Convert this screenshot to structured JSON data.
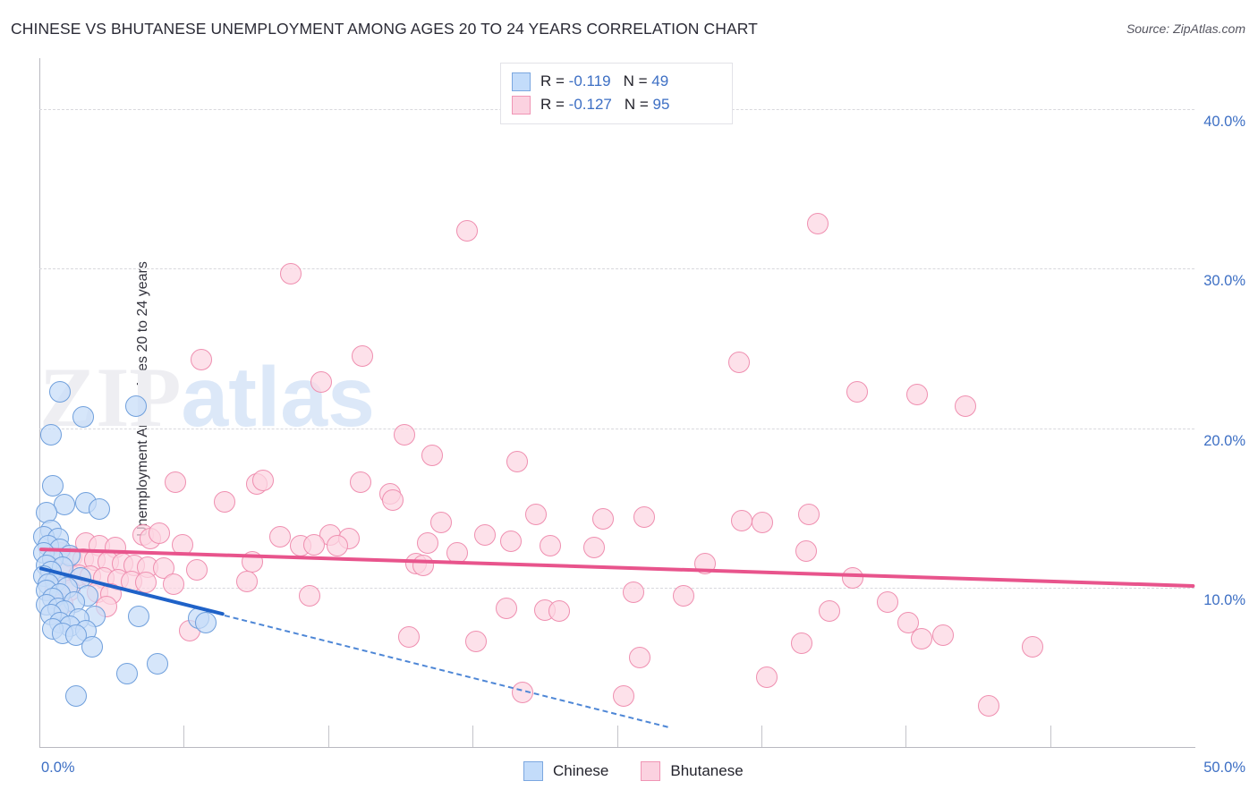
{
  "title": "CHINESE VS BHUTANESE UNEMPLOYMENT AMONG AGES 20 TO 24 YEARS CORRELATION CHART",
  "source": "Source: ZipAtlas.com",
  "watermark": {
    "part1": "ZIP",
    "part2": "atlas"
  },
  "stats": {
    "rows": [
      {
        "series": "Chinese",
        "r_label": "R = ",
        "r_value": "-0.119",
        "n_label": "N = ",
        "n_value": "49",
        "color": "#c3dcfa"
      },
      {
        "series": "Bhutanese",
        "r_label": "R = ",
        "r_value": "-0.127",
        "n_label": "N = ",
        "n_value": "95",
        "color": "#fbd2e0"
      }
    ]
  },
  "legend": {
    "items": [
      {
        "label": "Chinese",
        "color": "#c3dcfa"
      },
      {
        "label": "Bhutanese",
        "color": "#fbd2e0"
      }
    ]
  },
  "chart_data": {
    "type": "scatter",
    "title": "CHINESE VS BHUTANESE UNEMPLOYMENT AMONG AGES 20 TO 24 YEARS CORRELATION CHART",
    "xlabel": "",
    "ylabel": "Unemployment Among Ages 20 to 24 years",
    "xlim": [
      0,
      50
    ],
    "ylim": [
      0,
      43.2
    ],
    "grid": true,
    "x_ticks": [
      0,
      50
    ],
    "x_tick_labels": [
      "0.0%",
      "50.0%"
    ],
    "y_ticks": [
      10,
      20,
      30,
      40
    ],
    "y_tick_labels": [
      "10.0%",
      "20.0%",
      "30.0%",
      "40.0%"
    ],
    "legend_position": "bottom-center",
    "series": [
      {
        "name": "Chinese",
        "color": "#c3dcfa",
        "edge_color": "#6f9fdc",
        "r": -0.119,
        "n": 49,
        "trend": {
          "x0": 0.0,
          "y0": 11.2,
          "x1": 8.0,
          "y1": 8.3,
          "style": "solid"
        },
        "trend_extension": {
          "x0": 8.0,
          "y0": 8.3,
          "x1": 27.2,
          "y1": 1.3,
          "style": "dashed"
        },
        "points": [
          [
            0.9,
            22.3
          ],
          [
            4.2,
            21.4
          ],
          [
            1.9,
            20.7
          ],
          [
            0.5,
            19.6
          ],
          [
            0.6,
            16.4
          ],
          [
            1.1,
            15.2
          ],
          [
            2.0,
            15.3
          ],
          [
            2.6,
            14.9
          ],
          [
            0.3,
            14.7
          ],
          [
            0.5,
            13.6
          ],
          [
            0.2,
            13.2
          ],
          [
            0.8,
            13.1
          ],
          [
            0.4,
            12.6
          ],
          [
            0.9,
            12.4
          ],
          [
            0.2,
            12.2
          ],
          [
            1.3,
            12.0
          ],
          [
            0.6,
            11.8
          ],
          [
            0.3,
            11.4
          ],
          [
            1.0,
            11.3
          ],
          [
            0.5,
            11.0
          ],
          [
            0.2,
            10.7
          ],
          [
            1.8,
            10.6
          ],
          [
            0.7,
            10.4
          ],
          [
            0.4,
            10.2
          ],
          [
            1.2,
            10.0
          ],
          [
            0.3,
            9.8
          ],
          [
            0.9,
            9.6
          ],
          [
            2.1,
            9.5
          ],
          [
            0.6,
            9.3
          ],
          [
            1.5,
            9.1
          ],
          [
            0.3,
            8.9
          ],
          [
            0.8,
            8.7
          ],
          [
            1.1,
            8.5
          ],
          [
            0.5,
            8.3
          ],
          [
            2.4,
            8.2
          ],
          [
            1.7,
            8.0
          ],
          [
            0.9,
            7.8
          ],
          [
            1.3,
            7.6
          ],
          [
            0.6,
            7.4
          ],
          [
            2.0,
            7.3
          ],
          [
            1.0,
            7.1
          ],
          [
            1.6,
            7.0
          ],
          [
            4.3,
            8.2
          ],
          [
            6.9,
            8.1
          ],
          [
            7.2,
            7.8
          ],
          [
            2.3,
            6.3
          ],
          [
            5.1,
            5.2
          ],
          [
            3.8,
            4.6
          ],
          [
            1.6,
            3.2
          ]
        ]
      },
      {
        "name": "Bhutanese",
        "color": "#fbd2e0",
        "edge_color": "#ef8fb0",
        "r": -0.127,
        "n": 95,
        "trend": {
          "x0": 0.0,
          "y0": 12.4,
          "x1": 50.0,
          "y1": 10.1,
          "style": "solid"
        },
        "points": [
          [
            18.5,
            32.4
          ],
          [
            33.7,
            32.8
          ],
          [
            10.9,
            29.7
          ],
          [
            7.0,
            24.3
          ],
          [
            14.0,
            24.5
          ],
          [
            30.3,
            24.1
          ],
          [
            12.2,
            22.9
          ],
          [
            35.4,
            22.3
          ],
          [
            38.0,
            22.1
          ],
          [
            40.1,
            21.4
          ],
          [
            15.8,
            19.6
          ],
          [
            17.0,
            18.3
          ],
          [
            20.7,
            17.9
          ],
          [
            5.9,
            16.6
          ],
          [
            9.4,
            16.5
          ],
          [
            9.7,
            16.7
          ],
          [
            13.9,
            16.6
          ],
          [
            15.2,
            15.9
          ],
          [
            8.0,
            15.4
          ],
          [
            15.3,
            15.5
          ],
          [
            21.5,
            14.6
          ],
          [
            24.4,
            14.3
          ],
          [
            26.2,
            14.4
          ],
          [
            30.4,
            14.2
          ],
          [
            31.3,
            14.1
          ],
          [
            33.3,
            14.6
          ],
          [
            17.4,
            14.1
          ],
          [
            4.5,
            13.3
          ],
          [
            4.8,
            13.1
          ],
          [
            5.2,
            13.4
          ],
          [
            10.4,
            13.2
          ],
          [
            12.6,
            13.3
          ],
          [
            13.4,
            13.1
          ],
          [
            19.3,
            13.3
          ],
          [
            20.4,
            12.9
          ],
          [
            2.0,
            12.8
          ],
          [
            2.6,
            12.6
          ],
          [
            3.3,
            12.5
          ],
          [
            6.2,
            12.7
          ],
          [
            11.3,
            12.6
          ],
          [
            11.9,
            12.7
          ],
          [
            12.9,
            12.6
          ],
          [
            16.8,
            12.8
          ],
          [
            18.1,
            12.2
          ],
          [
            22.1,
            12.6
          ],
          [
            24.0,
            12.5
          ],
          [
            33.2,
            12.3
          ],
          [
            0.9,
            12.2
          ],
          [
            1.4,
            11.9
          ],
          [
            1.9,
            11.8
          ],
          [
            2.4,
            11.7
          ],
          [
            3.0,
            11.6
          ],
          [
            3.6,
            11.5
          ],
          [
            4.1,
            11.4
          ],
          [
            4.7,
            11.3
          ],
          [
            5.4,
            11.2
          ],
          [
            6.8,
            11.1
          ],
          [
            9.2,
            11.6
          ],
          [
            16.3,
            11.5
          ],
          [
            16.6,
            11.4
          ],
          [
            28.8,
            11.5
          ],
          [
            0.5,
            11.0
          ],
          [
            1.1,
            10.9
          ],
          [
            1.7,
            10.8
          ],
          [
            2.2,
            10.7
          ],
          [
            2.8,
            10.6
          ],
          [
            3.4,
            10.5
          ],
          [
            4.0,
            10.4
          ],
          [
            4.6,
            10.3
          ],
          [
            5.8,
            10.2
          ],
          [
            9.0,
            10.4
          ],
          [
            35.2,
            10.6
          ],
          [
            0.7,
            9.9
          ],
          [
            1.3,
            9.8
          ],
          [
            2.5,
            9.7
          ],
          [
            3.1,
            9.6
          ],
          [
            11.7,
            9.5
          ],
          [
            25.7,
            9.7
          ],
          [
            27.9,
            9.5
          ],
          [
            36.7,
            9.1
          ],
          [
            1.0,
            9.0
          ],
          [
            2.9,
            8.8
          ],
          [
            20.2,
            8.7
          ],
          [
            21.9,
            8.6
          ],
          [
            22.5,
            8.5
          ],
          [
            34.2,
            8.5
          ],
          [
            37.6,
            7.8
          ],
          [
            6.5,
            7.3
          ],
          [
            16.0,
            6.9
          ],
          [
            18.9,
            6.6
          ],
          [
            33.0,
            6.5
          ],
          [
            38.2,
            6.8
          ],
          [
            39.1,
            7.0
          ],
          [
            43.0,
            6.3
          ],
          [
            26.0,
            5.6
          ],
          [
            31.5,
            4.4
          ],
          [
            20.9,
            3.4
          ],
          [
            25.3,
            3.2
          ],
          [
            41.1,
            2.6
          ]
        ]
      }
    ]
  },
  "axes": {
    "y_title": "Unemployment Among Ages 20 to 24 years",
    "x_min_label": "0.0%",
    "x_max_label": "50.0%",
    "y_labels": [
      "40.0%",
      "30.0%",
      "20.0%",
      "10.0%"
    ]
  }
}
